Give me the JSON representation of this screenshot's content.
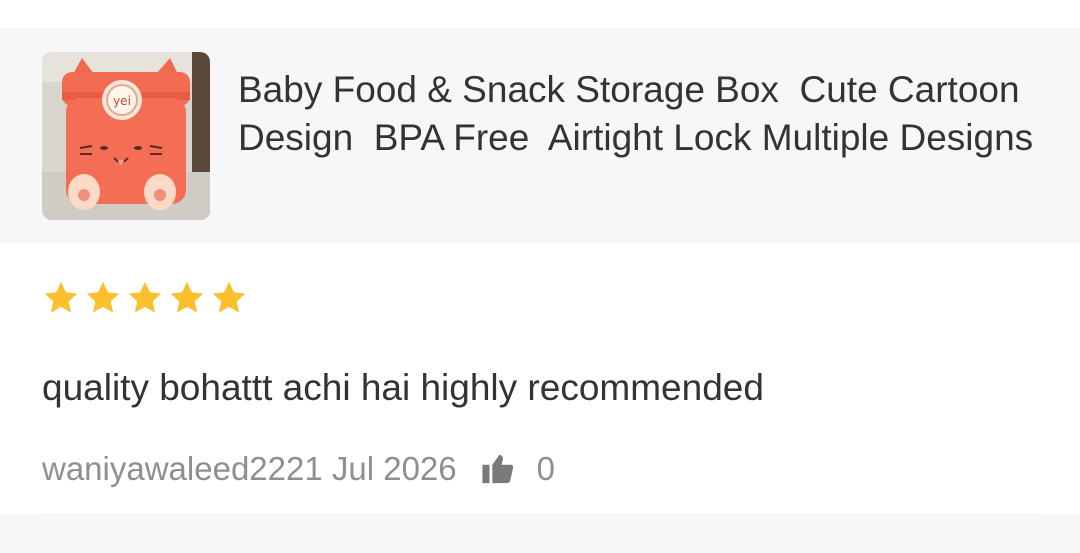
{
  "product": {
    "title": "Baby Food & Snack Storage Box  Cute Cartoon Design  BPA Free  Airtight Lock Multiple Designs",
    "image_label": "yei",
    "image_icon": "orange-cat-storage-box-image"
  },
  "review": {
    "rating": 5,
    "max_rating": 5,
    "star_color": "#fbc02d",
    "text": "quality bohattt achi hai highly recommended",
    "author_date": "waniyawaleed2221 Jul 2026",
    "like_count": "0",
    "like_icon": "thumbs-up-icon"
  }
}
